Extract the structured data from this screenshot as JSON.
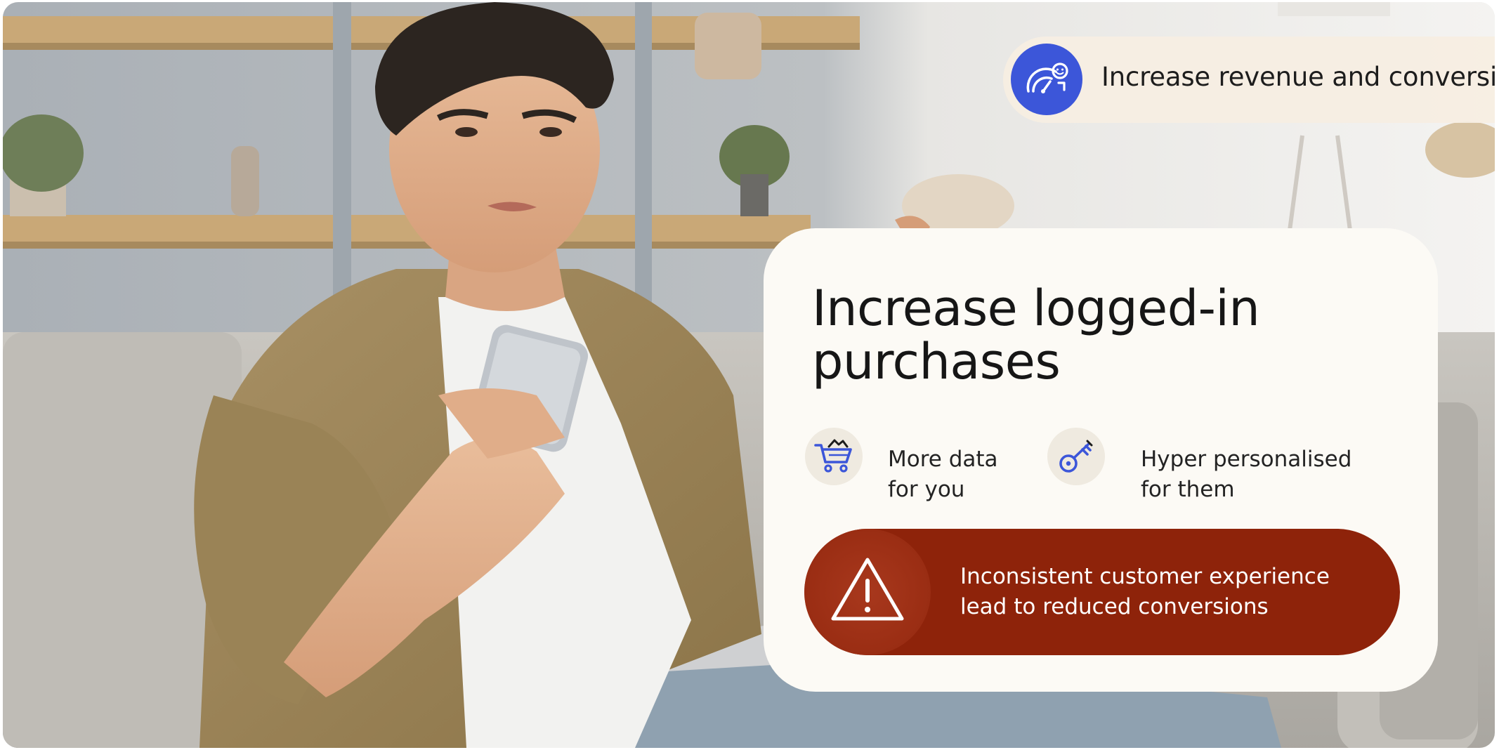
{
  "banner": {
    "text": "Increase revenue and conversion",
    "icon": "speedometer-smile-icon",
    "icon_bg": "#3c56d9"
  },
  "card": {
    "title": "Increase logged-in purchases",
    "features": [
      {
        "icon": "shopping-cart-icon",
        "line1": "More data",
        "line2": "for you"
      },
      {
        "icon": "key-icon",
        "line1": "Hyper personalised",
        "line2": "for them"
      }
    ]
  },
  "alert": {
    "icon": "warning-triangle-icon",
    "line1": "Inconsistent customer experience",
    "line2": "lead to reduced conversions",
    "bg": "#8e230a"
  },
  "photo": {
    "subject": "young man on sofa looking confused at phone"
  }
}
